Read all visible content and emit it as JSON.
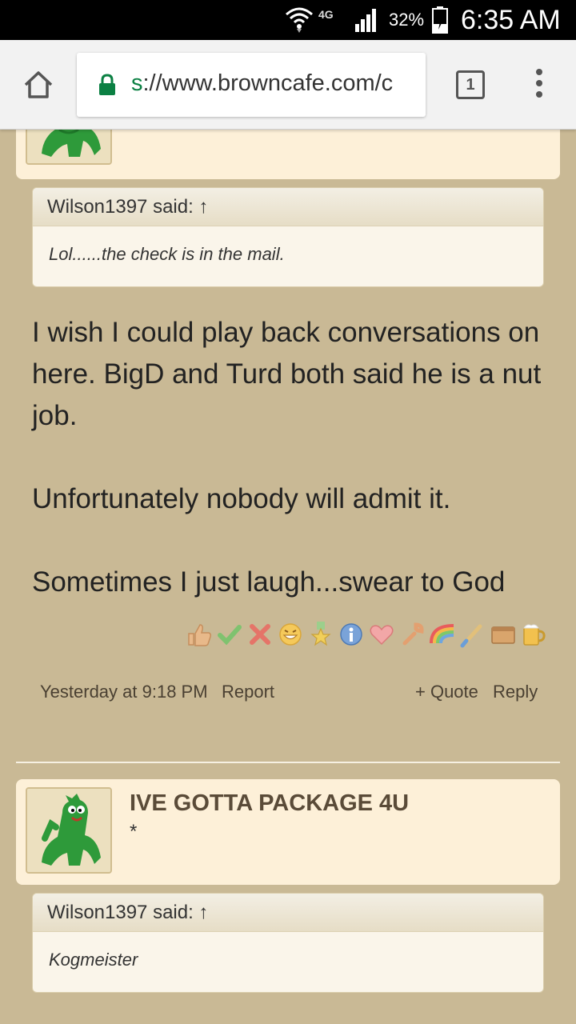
{
  "status_bar": {
    "network": "4G",
    "battery_percent": "32%",
    "time": "6:35 AM"
  },
  "browser": {
    "url_scheme": "s",
    "url_rest": "://www.browncafe.com/c",
    "tab_count": "1"
  },
  "post": {
    "quote": {
      "author_line": "Wilson1397 said: ↑",
      "text": "Lol......the check is in the mail."
    },
    "message": [
      "I wish I could play back conversations on here. BigD and Turd both said he is a nut job.",
      "Unfortunately nobody will admit it.",
      "Sometimes I just laugh...swear to God"
    ],
    "reactions": [
      "like-icon",
      "agree-icon",
      "disagree-icon",
      "funny-icon",
      "winner-icon",
      "informative-icon",
      "love-icon",
      "useful-icon",
      "rainbow-icon",
      "creative-icon",
      "box-icon",
      "beer-icon"
    ],
    "timestamp": "Yesterday at 9:18 PM",
    "report_label": "Report",
    "quote_label": "+ Quote",
    "reply_label": "Reply"
  },
  "next_post": {
    "user_title": "IVE GOTTA PACKAGE 4U",
    "user_star": "*",
    "quote": {
      "author_line": "Wilson1397 said: ↑",
      "text": "Kogmeister"
    }
  }
}
